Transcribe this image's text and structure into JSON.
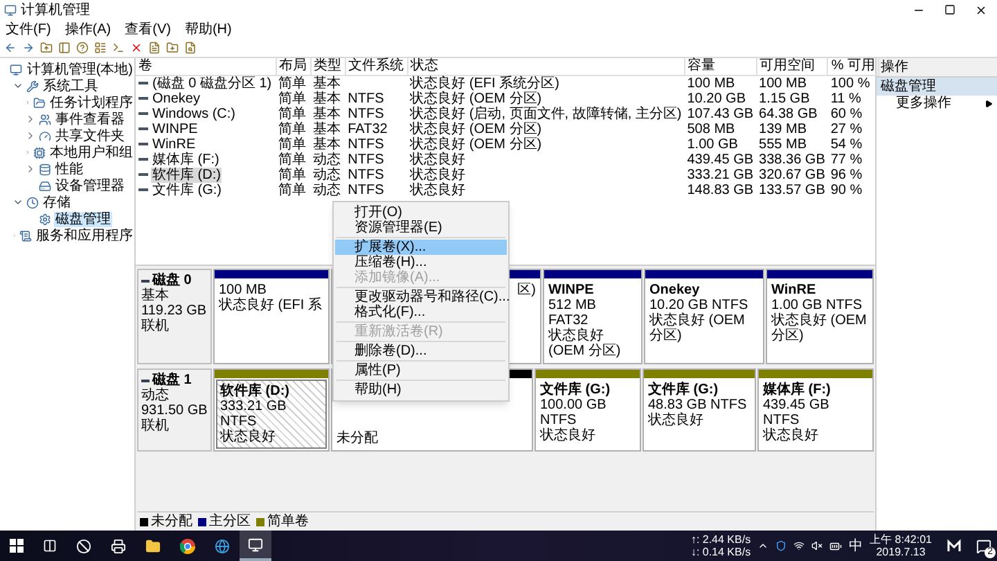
{
  "window": {
    "title": "计算机管理"
  },
  "menu_bar": [
    "文件(F)",
    "操作(A)",
    "查看(V)",
    "帮助(H)"
  ],
  "tree": [
    {
      "label": "计算机管理(本地)",
      "selected": false,
      "children": [
        {
          "label": "系统工具",
          "expanded": true,
          "selected": false,
          "children": [
            {
              "label": "任务计划程序",
              "expanded": false,
              "selected": false
            },
            {
              "label": "事件查看器",
              "expanded": false,
              "selected": false
            },
            {
              "label": "共享文件夹",
              "expanded": false,
              "selected": false
            },
            {
              "label": "本地用户和组",
              "expanded": false,
              "selected": false
            },
            {
              "label": "性能",
              "expanded": false,
              "selected": false
            },
            {
              "label": "设备管理器",
              "selected": false
            }
          ]
        },
        {
          "label": "存储",
          "expanded": true,
          "selected": false,
          "children": [
            {
              "label": "磁盘管理",
              "selected": true
            }
          ]
        },
        {
          "label": "服务和应用程序",
          "expanded": false,
          "selected": false
        }
      ]
    }
  ],
  "table": {
    "columns": [
      "卷",
      "布局",
      "类型",
      "文件系统",
      "状态",
      "容量",
      "可用空间",
      "% 可用"
    ],
    "rows": [
      {
        "volume": "(磁盘 0 磁盘分区 1)",
        "layout": "简单",
        "type": "基本",
        "status": "状态良好 (EFI 系统分区)",
        "capacity": "100 MB",
        "free": "100 MB",
        "percent_free": "100 %",
        "selected": false
      },
      {
        "volume": "Onekey",
        "layout": "简单",
        "type": "基本",
        "filesystem": "NTFS",
        "status": "状态良好 (OEM 分区)",
        "capacity": "10.20 GB",
        "free": "1.15 GB",
        "percent_free": "11 %",
        "selected": false
      },
      {
        "volume": "Windows (C:)",
        "layout": "简单",
        "type": "基本",
        "filesystem": "NTFS",
        "status": "状态良好 (启动, 页面文件, 故障转储, 主分区)",
        "capacity": "107.43 GB",
        "free": "64.38 GB",
        "percent_free": "60 %",
        "selected": false
      },
      {
        "volume": "WINPE",
        "layout": "简单",
        "type": "基本",
        "filesystem": "FAT32",
        "status": "状态良好 (OEM 分区)",
        "capacity": "508 MB",
        "free": "139 MB",
        "percent_free": "27 %",
        "selected": false
      },
      {
        "volume": "WinRE",
        "layout": "简单",
        "type": "基本",
        "filesystem": "NTFS",
        "status": "状态良好 (OEM 分区)",
        "capacity": "1.00 GB",
        "free": "555 MB",
        "percent_free": "54 %",
        "selected": false
      },
      {
        "volume": "媒体库 (F:)",
        "layout": "简单",
        "type": "动态",
        "filesystem": "NTFS",
        "status": "状态良好",
        "capacity": "439.45 GB",
        "free": "338.36 GB",
        "percent_free": "77 %",
        "selected": false
      },
      {
        "volume": "软件库 (D:)",
        "layout": "简单",
        "type": "动态",
        "filesystem": "NTFS",
        "status": "状态良好",
        "capacity": "333.21 GB",
        "free": "320.67 GB",
        "percent_free": "96 %",
        "selected": true
      },
      {
        "volume": "文件库 (G:)",
        "layout": "简单",
        "type": "动态",
        "filesystem": "NTFS",
        "status": "状态良好",
        "capacity": "148.83 GB",
        "free": "133.57 GB",
        "percent_free": "90 %",
        "selected": false
      }
    ]
  },
  "disks": [
    {
      "name": "磁盘 0",
      "type": "基本",
      "size": "119.23 GB",
      "state": "联机",
      "partitions": [
        {
          "kind": "primary",
          "selected": false,
          "lines": [
            "100 MB",
            "状态良好 (EFI 系"
          ]
        },
        {
          "kind": "primary",
          "selected": false,
          "lines": [
            "区)"
          ]
        },
        {
          "kind": "primary",
          "selected": false,
          "name": "WINPE",
          "lines": [
            "512 MB FAT32",
            "状态良好 (OEM 分区)"
          ]
        },
        {
          "kind": "primary",
          "selected": false,
          "name": "Onekey",
          "lines": [
            "10.20 GB NTFS",
            "状态良好 (OEM 分区)"
          ]
        },
        {
          "kind": "primary",
          "selected": false,
          "name": "WinRE",
          "lines": [
            "1.00 GB NTFS",
            "状态良好 (OEM 分区)"
          ]
        }
      ]
    },
    {
      "name": "磁盘 1",
      "type": "动态",
      "size": "931.50 GB",
      "state": "联机",
      "partitions": [
        {
          "kind": "simple",
          "selected": true,
          "name": "软件库 (D:)",
          "lines": [
            "333.21 GB NTFS",
            "状态良好"
          ]
        },
        {
          "kind": "unallocated",
          "selected": false,
          "lines": [
            "未分配"
          ]
        },
        {
          "kind": "simple",
          "selected": false,
          "name": "文件库 (G:)",
          "lines": [
            "100.00 GB NTFS",
            "状态良好"
          ]
        },
        {
          "kind": "simple",
          "selected": false,
          "name": "文件库 (G:)",
          "lines": [
            "48.83 GB NTFS",
            "状态良好"
          ]
        },
        {
          "kind": "simple",
          "selected": false,
          "name": "媒体库 (F:)",
          "lines": [
            "439.45 GB NTFS",
            "状态良好"
          ]
        }
      ]
    }
  ],
  "legend": [
    {
      "kind": "unallocated",
      "label": "未分配"
    },
    {
      "kind": "primary",
      "label": "主分区"
    },
    {
      "kind": "simple",
      "label": "简单卷"
    }
  ],
  "context_menu": [
    {
      "kind": "item",
      "label": "打开(O)",
      "selected": false,
      "disabled": false
    },
    {
      "kind": "item",
      "label": "资源管理器(E)",
      "selected": false,
      "disabled": false
    },
    {
      "kind": "separator"
    },
    {
      "kind": "item",
      "label": "扩展卷(X)...",
      "selected": true,
      "disabled": false
    },
    {
      "kind": "item",
      "label": "压缩卷(H)...",
      "selected": false,
      "disabled": false
    },
    {
      "kind": "item",
      "label": "添加镜像(A)...",
      "selected": false,
      "disabled": true
    },
    {
      "kind": "separator"
    },
    {
      "kind": "item",
      "label": "更改驱动器号和路径(C)...",
      "selected": false,
      "disabled": false
    },
    {
      "kind": "item",
      "label": "格式化(F)...",
      "selected": false,
      "disabled": false
    },
    {
      "kind": "separator"
    },
    {
      "kind": "item",
      "label": "重新激活卷(R)",
      "selected": false,
      "disabled": true
    },
    {
      "kind": "separator"
    },
    {
      "kind": "item",
      "label": "删除卷(D)...",
      "selected": false,
      "disabled": false
    },
    {
      "kind": "separator"
    },
    {
      "kind": "item",
      "label": "属性(P)",
      "selected": false,
      "disabled": false
    },
    {
      "kind": "separator"
    },
    {
      "kind": "item",
      "label": "帮助(H)",
      "selected": false,
      "disabled": false
    }
  ],
  "actions_panel": {
    "title": "操作",
    "items": [
      {
        "kind": "section",
        "label": "磁盘管理"
      },
      {
        "kind": "action",
        "label": "更多操作"
      }
    ]
  },
  "taskbar": {
    "upload": "↑: 2.44 KB/s",
    "download": "↓: 0.14 KB/s",
    "ime": "中",
    "time": "上午 8:42:01",
    "date": "2019.7.13",
    "notification_count": "2"
  }
}
